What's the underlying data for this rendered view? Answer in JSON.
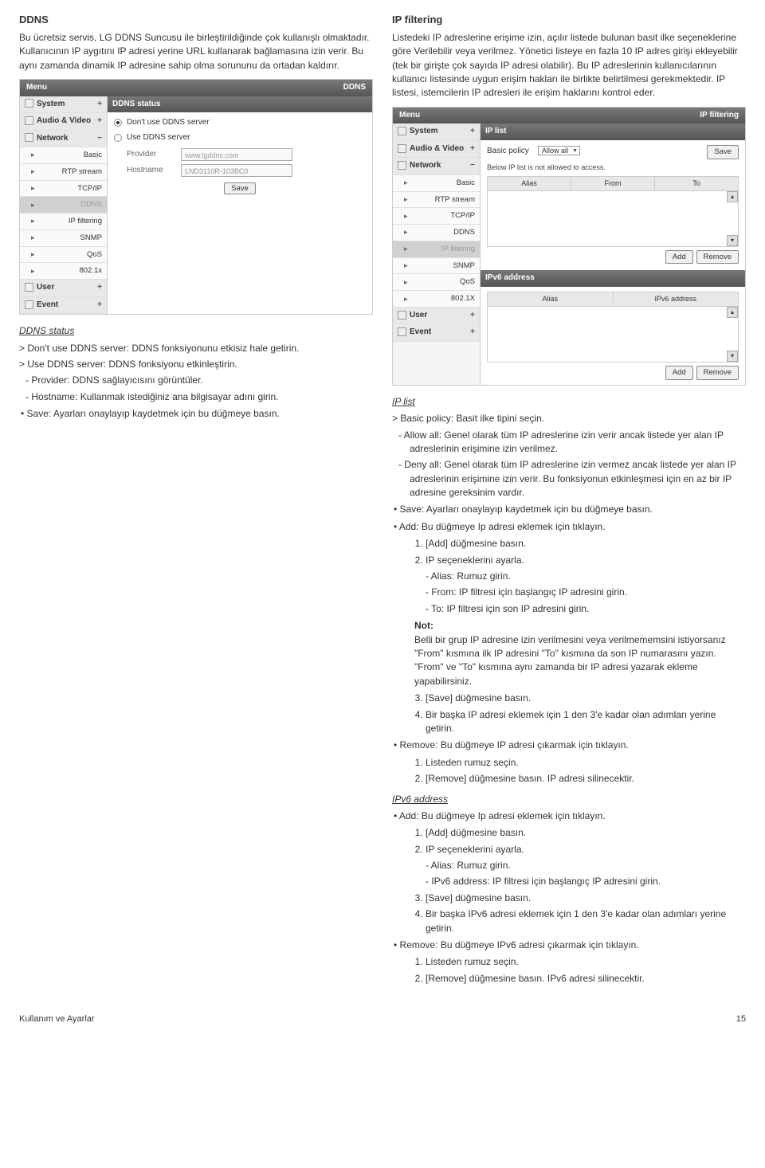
{
  "left": {
    "title": "DDNS",
    "intro": "Bu ücretsiz servis, LG DDNS Suncusu ile birleştirildiğinde çok kullanışlı olmaktadır. Kullanıcının IP aygıtını IP adresi yerine URL kullanarak bağlamasına izin verir. Bu aynı zamanda dinamik IP adresine sahip olma sorununu da ortadan kaldırır.",
    "panel": {
      "menu": "Menu",
      "tag": "DDNS",
      "system": "System",
      "audio": "Audio & Video",
      "network": "Network",
      "items": [
        "Basic",
        "RTP stream",
        "TCP/IP",
        "DDNS",
        "IP filtering",
        "SNMP",
        "QoS",
        "802.1x"
      ],
      "user": "User",
      "event": "Event",
      "content_title": "DDNS status",
      "radio1": "Don't use DDNS server",
      "radio2": "Use DDNS server",
      "provider_lbl": "Provider",
      "provider_val": "www.lgddns.com",
      "hostname_lbl": "Hostname",
      "hostname_val": "LND3110R-103BC0",
      "save": "Save"
    },
    "subhead": "DDNS status",
    "li1": "Don't use DDNS server: DDNS fonksiyonunu etkisiz hale getirin.",
    "li2": "Use DDNS server: DDNS fonksiyonu etkinleştirin.",
    "d1": "Provider: DDNS sağlayıcısını görüntüler.",
    "d2": "Hostname: Kullanmak istediğiniz ana bilgisayar adını girin.",
    "save_desc": "Save: Ayarları onaylayıp kaydetmek için bu düğmeye basın."
  },
  "right": {
    "title": "IP filtering",
    "intro": "Listedeki IP adreslerine erişime izin, açılır listede bulunan basit ilke seçeneklerine göre Verilebilir veya verilmez. Yönetici listeye en fazla 10 IP adres girişi ekleyebilir (tek bir girişte çok sayıda IP adresi olabilir). Bu IP adreslerinin kullanıcılarının kullanıcı listesinde uygun erişim hakları ile birlikte belirtilmesi gerekmektedir. IP listesi, istemcilerin IP adresleri ile erişim haklarını kontrol eder.",
    "panel": {
      "menu": "Menu",
      "tag": "IP filtering",
      "system": "System",
      "audio": "Audio & Video",
      "network": "Network",
      "items": [
        "Basic",
        "RTP stream",
        "TCP/IP",
        "DDNS",
        "IP filtering",
        "SNMP",
        "QoS",
        "802.1X"
      ],
      "user": "User",
      "event": "Event",
      "ip_list": "IP list",
      "basic_policy": "Basic policy",
      "allow_all": "Allow all",
      "save": "Save",
      "below_txt": "Below IP list is not allowed to access.",
      "col_alias": "Alias",
      "col_from": "From",
      "col_to": "To",
      "add": "Add",
      "remove": "Remove",
      "ipv6_title": "IPv6 address",
      "col_ipv6": "IPv6 address"
    },
    "subhead1": "IP list",
    "basic_policy": "Basic policy: Basit ilke tipini seçin.",
    "allow_all": "Allow all: Genel olarak tüm IP adreslerine izin verir ancak listede yer alan IP adreslerinin erişimine izin verilmez.",
    "deny_all": "Deny all: Genel olarak tüm IP adreslerine izin vermez ancak listede yer alan IP adreslerinin erişimine izin verir. Bu fonksiyonun etkinleşmesi için en az bir IP adresine gereksinim vardır.",
    "save_desc": "Save: Ayarları onaylayıp kaydetmek için bu düğmeye basın.",
    "add_desc": "Add: Bu düğmeye Ip adresi eklemek için tıklayın.",
    "a1": "[Add] düğmesine basın.",
    "a2": "IP seçeneklerini ayarla.",
    "a2d1": "Alias: Rumuz girin.",
    "a2d2": "From: IP filtresi için başlangıç IP adresini girin.",
    "a2d3": "To: IP filtresi için son IP adresini girin.",
    "note_label": "Not:",
    "note_body": "Belli bir grup IP adresine izin verilmesini veya verilmememsini istiyorsanız \"From\" kısmına ilk IP adresini \"To\" kısmına da son IP numarasını yazın. \"From\" ve \"To\" kısmına aynı zamanda bir IP adresi yazarak ekleme yapabilirsiniz.",
    "a3": "[Save] düğmesine basın.",
    "a4": "Bir başka IP adresi eklemek için 1 den 3'e kadar olan adımları yerine getirin.",
    "rem_desc": "Remove: Bu düğmeye IP adresi çıkarmak için tıklayın.",
    "r1": "Listeden rumuz seçin.",
    "r2": "[Remove] düğmesine basın. IP adresi silinecektir.",
    "subhead2": "IPv6 address",
    "add6_desc": "Add: Bu düğmeye Ip adresi eklemek için tıklayın.",
    "b1": "[Add] düğmesine basın.",
    "b2": "IP seçeneklerini ayarla.",
    "b2d1": "Alias: Rumuz girin.",
    "b2d2": "IPv6 address:  IP filtresi için başlangıç IP adresini girin.",
    "b3": "[Save] düğmesine basın.",
    "b4": "Bir başka IPv6 adresi eklemek için 1 den 3'e kadar olan adımları yerine getirin.",
    "rem6_desc": "Remove: Bu düğmeye IPv6 adresi çıkarmak için tıklayın.",
    "r61": "Listeden rumuz seçin.",
    "r62": "[Remove] düğmesine basın. IPv6 adresi silinecektir."
  },
  "footer": {
    "left": "Kullanım ve Ayarlar",
    "right": "15"
  }
}
